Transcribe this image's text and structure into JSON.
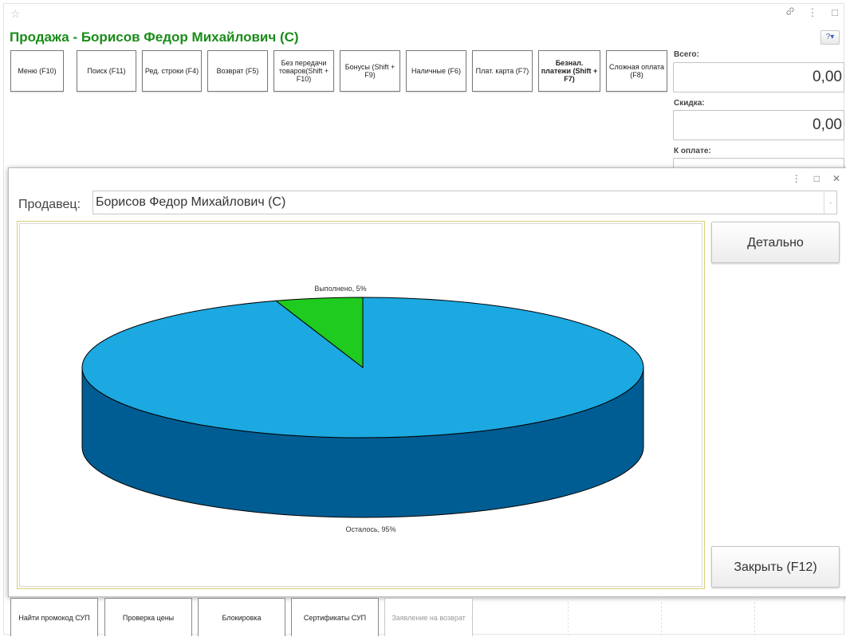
{
  "window": {
    "title": "Продажа - Борисов Федор Михайлович (С)",
    "star_icon": "☆",
    "link_icon": "🔗",
    "more_icon": "⋮",
    "maximize_icon": "□",
    "help_label": "?▾"
  },
  "toolbar": {
    "buttons": [
      {
        "label": "Меню (F10)",
        "bold": false
      },
      {
        "label": "Поиск (F11)",
        "bold": false
      },
      {
        "label": "Ред. строки (F4)",
        "bold": false
      },
      {
        "label": "Возврат (F5)",
        "bold": false
      },
      {
        "label": "Без передачи товаров(Shift + F10)",
        "bold": false
      },
      {
        "label": "Бонусы (Shift + F9)",
        "bold": false
      },
      {
        "label": "Наличные (F6)",
        "bold": false
      },
      {
        "label": "Плат. карта (F7)",
        "bold": false
      },
      {
        "label": "Безнал. платежи (Shift + F7)",
        "bold": true
      },
      {
        "label": "Сложная оплата (F8)",
        "bold": false
      }
    ]
  },
  "summary": {
    "total_label": "Всего:",
    "total_value": "0,00",
    "discount_label": "Скидка:",
    "discount_value": "0,00",
    "to_pay_label": "К оплате:"
  },
  "dialog": {
    "more_icon": "⋮",
    "maximize_icon": "□",
    "close_icon": "✕",
    "seller_label": "Продавец:",
    "seller_value": "Борисов Федор Михайлович (С)",
    "dropdown_icon": "-",
    "detail_button": "Детально",
    "close_button": "Закрыть (F12)"
  },
  "chart_data": {
    "type": "pie",
    "style": "3d",
    "slices": [
      {
        "label": "Выполнено, 5%",
        "value": 5,
        "color": "#1ecb1e"
      },
      {
        "label": "Осталось, 95%",
        "value": 95,
        "color": "#1ca8e0",
        "side_color": "#005d93"
      }
    ]
  },
  "bottom_bar": {
    "buttons": [
      {
        "label": "Найти промокод СУП",
        "disabled": false
      },
      {
        "label": "Проверка цены",
        "disabled": false
      },
      {
        "label": "Блокировка",
        "disabled": false
      },
      {
        "label": "Сертификаты СУП",
        "disabled": false
      },
      {
        "label": "Заявление на возврат",
        "disabled": true
      }
    ]
  }
}
